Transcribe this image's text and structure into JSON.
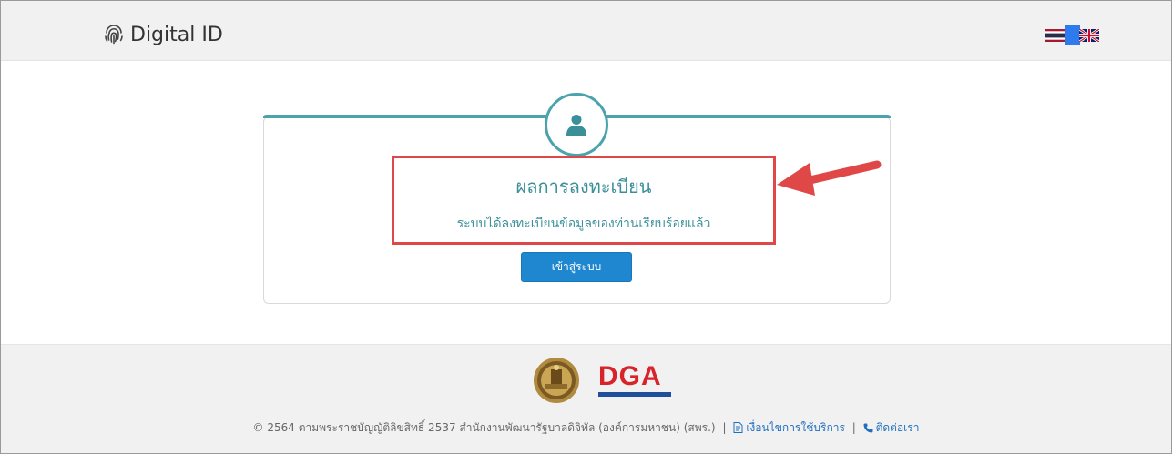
{
  "header": {
    "brand_icon": "fingerprint-icon",
    "brand_text": "Digital ID",
    "languages": [
      "th",
      "en"
    ],
    "selected_language": "th"
  },
  "card": {
    "icon": "user-icon",
    "title": "ผลการลงทะเบียน",
    "message": "ระบบได้ลงทะเบียนข้อมูลของท่านเรียบร้อยแล้ว",
    "button_label": "เข้าสู่ระบบ"
  },
  "footer": {
    "logos": [
      "government-seal",
      "DGA"
    ],
    "dga_text": "DGA",
    "copyright": "© 2564 ตามพระราชบัญญัติลิขสิทธิ์ 2537 สำนักงานพัฒนารัฐบาลดิจิทัล (องค์การมหาชน) (สพร.)",
    "terms_label": "เงื่อนไขการใช้บริการ",
    "contact_label": "ติดต่อเรา",
    "separator": "|"
  },
  "colors": {
    "accent": "#4aa3ad",
    "button": "#1e87cf",
    "highlight": "#e04848",
    "dga_red": "#d8232a"
  }
}
